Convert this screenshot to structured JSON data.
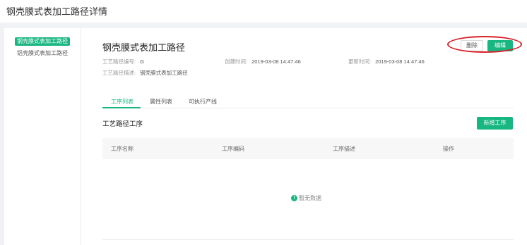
{
  "page": {
    "title": "钢壳膜式表加工路径详情"
  },
  "sidebar": {
    "items": [
      {
        "label": "钢壳膜式表加工路径",
        "active": true
      },
      {
        "label": "铝壳膜式表加工路径",
        "active": false
      }
    ]
  },
  "detail": {
    "name": "钢壳膜式表加工路径",
    "code_label": "工艺路径编号:",
    "code_value": "G",
    "created_label": "创建时间:",
    "created_value": "2019-03-08 14:47:46",
    "updated_label": "更新时间:",
    "updated_value": "2019-03-08 14:47:46",
    "desc_label": "工艺路径描述:",
    "desc_value": "钢壳膜式表加工路径"
  },
  "actions": {
    "delete_label": "删除",
    "edit_label": "编辑"
  },
  "tabs": [
    {
      "label": "工序列表",
      "active": true
    },
    {
      "label": "属性列表",
      "active": false
    },
    {
      "label": "可执行产线",
      "active": false
    }
  ],
  "section": {
    "title": "工艺路径工序",
    "add_label": "新增工序"
  },
  "table": {
    "columns": [
      "工序名称",
      "工序编码",
      "工序描述",
      "操作"
    ],
    "rows": [],
    "empty_text": "暂无数据"
  },
  "colors": {
    "accent": "#18b681",
    "annotation": "#d8202a"
  },
  "icons": {
    "empty": "info-circle-icon"
  }
}
